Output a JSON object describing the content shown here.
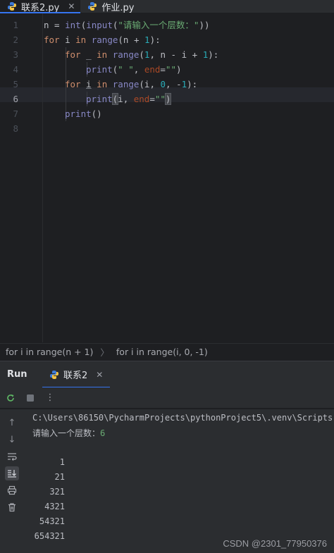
{
  "tabs": [
    {
      "label": "联系2.py",
      "active": true,
      "icon": "python-icon"
    },
    {
      "label": "作业.py",
      "active": false,
      "icon": "python-icon"
    }
  ],
  "editor": {
    "line_numbers": [
      "1",
      "2",
      "3",
      "4",
      "5",
      "6",
      "7",
      "8"
    ],
    "current_line": 6
  },
  "breadcrumb": {
    "items": [
      "for i in range(n + 1)",
      "for i in range(i, 0, -1)"
    ]
  },
  "run": {
    "title": "Run",
    "tab_label": "联系2",
    "output": {
      "path": "C:\\Users\\86150\\PycharmProjects\\pythonProject5\\.venv\\Scripts",
      "prompt": "请输入一个层数：",
      "input_value": "6",
      "triangle": [
        "1",
        "21",
        "321",
        "4321",
        "54321",
        "654321"
      ]
    }
  },
  "watermark": "CSDN @2301_77950376",
  "colors": {
    "keyword": "#cf8e6d",
    "function": "#56a8f5",
    "builtin": "#8888c6",
    "string": "#6aab73",
    "number": "#2aacb8",
    "param": "#aa4926",
    "accent": "#3574f0"
  }
}
